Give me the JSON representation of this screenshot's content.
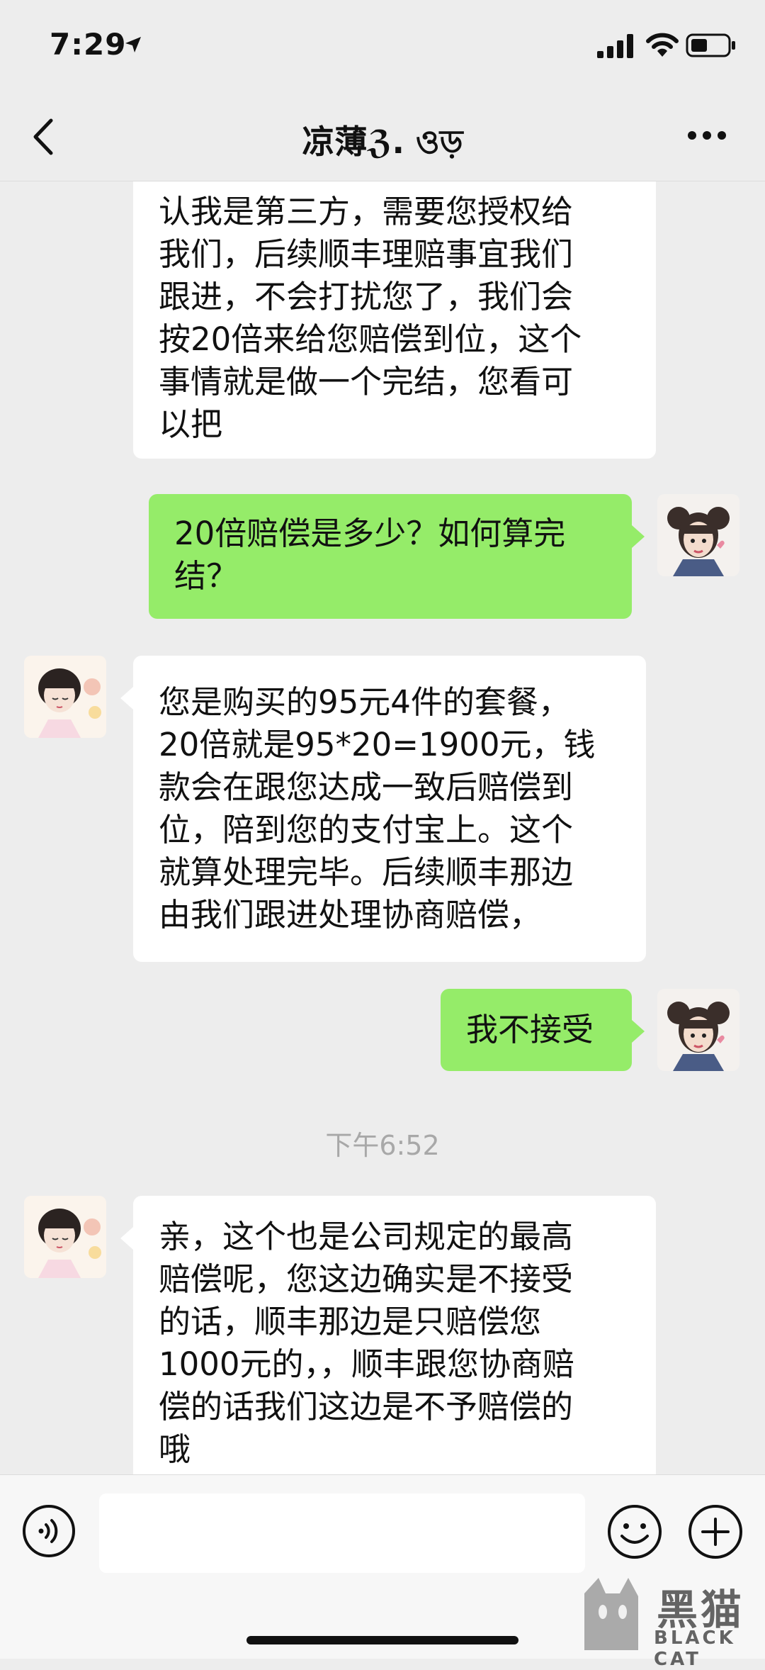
{
  "status_bar": {
    "time": "7:29"
  },
  "nav": {
    "title": "凉薄ℨ. ও‌ড়"
  },
  "messages": [
    {
      "side": "left",
      "lines": [
        "认我是第三方，需要您授权给",
        "我们，后续顺丰理赔事宜我们",
        "跟进，不会打扰您了，我们会",
        "按20倍来给您赔偿到位，这个",
        "事情就是做一个完结，您看可",
        "以把"
      ]
    },
    {
      "side": "right",
      "lines": [
        "20倍赔偿是多少？如何算完",
        "结？"
      ]
    },
    {
      "side": "left",
      "lines": [
        "您是购买的95元4件的套餐，",
        "20倍就是95*20=1900元，钱",
        "款会在跟您达成一致后赔偿到",
        "位，陪到您的支付宝上。这个",
        "就算处理完毕。后续顺丰那边",
        "由我们跟进处理协商赔偿，"
      ]
    },
    {
      "side": "right",
      "lines": [
        "我不接受"
      ]
    },
    {
      "side": "left",
      "lines": [
        "亲，这个也是公司规定的最高",
        "赔偿呢，您这边确实是不接受",
        "的话，顺丰那边是只赔偿您",
        "1000元的，，顺丰跟您协商赔",
        "偿的话我们这边是不予赔偿的",
        "哦"
      ]
    }
  ],
  "timestamp": "下午6:52",
  "input": {
    "value": ""
  },
  "watermark": {
    "main": "黑猫",
    "sub": "BLACK CAT"
  },
  "colors": {
    "self_bubble": "#95ec69",
    "other_bubble": "#ffffff",
    "background": "#ededed"
  },
  "icons": [
    "location-arrow-icon",
    "signal-icon",
    "wifi-icon",
    "battery-icon",
    "back-icon",
    "more-icon",
    "voice-icon",
    "emoji-icon",
    "plus-icon"
  ]
}
